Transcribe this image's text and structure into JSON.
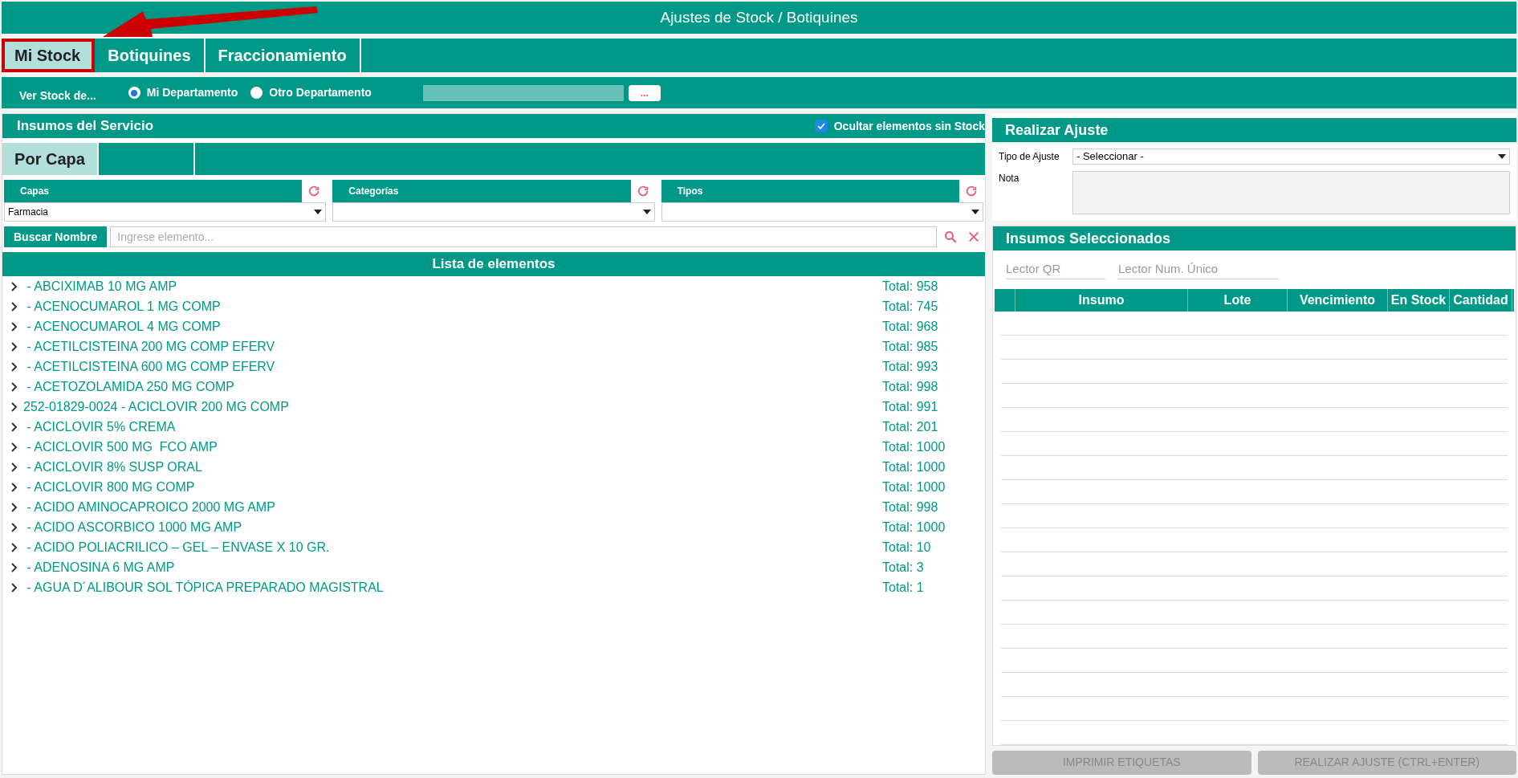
{
  "window": {
    "title": "Ajustes de Stock / Botiquines"
  },
  "tabs": [
    {
      "label": "Mi Stock",
      "selected": true,
      "highlighted": true
    },
    {
      "label": "Botiquines",
      "selected": false,
      "highlighted": false
    },
    {
      "label": "Fraccionamiento",
      "selected": false,
      "highlighted": false
    }
  ],
  "ver_stock": {
    "label": "Ver Stock de...",
    "options": [
      {
        "label": "Mi Departamento",
        "selected": true
      },
      {
        "label": "Otro Departamento",
        "selected": false
      }
    ],
    "browse_button": "..."
  },
  "insumos": {
    "title": "Insumos del Servicio",
    "hide_empty": {
      "label": "Ocultar elementos sin Stock",
      "checked": true
    },
    "subtabs": [
      {
        "label": "Por Capa",
        "selected": true
      }
    ],
    "filters": [
      {
        "label": "Capas",
        "value": "Farmacia"
      },
      {
        "label": "Categorías"
      },
      {
        "label": "Tipos"
      }
    ],
    "search": {
      "label": "Buscar Nombre",
      "placeholder": "Ingrese elemento..."
    },
    "list_title": "Lista de elementos",
    "items": [
      {
        "name": " - ABCIXIMAB 10 MG AMP",
        "total": "Total: 958"
      },
      {
        "name": " - ACENOCUMAROL 1 MG COMP",
        "total": "Total: 745"
      },
      {
        "name": " - ACENOCUMAROL 4 MG COMP",
        "total": "Total: 968"
      },
      {
        "name": " - ACETILCISTEINA 200 MG COMP EFERV",
        "total": "Total: 985"
      },
      {
        "name": " - ACETILCISTEINA 600 MG COMP EFERV",
        "total": "Total: 993"
      },
      {
        "name": " - ACETOZOLAMIDA 250 MG COMP",
        "total": "Total: 998"
      },
      {
        "name": "252-01829-0024 - ACICLOVIR 200 MG COMP",
        "total": "Total: 991"
      },
      {
        "name": " - ACICLOVIR 5% CREMA",
        "total": "Total: 201"
      },
      {
        "name": " - ACICLOVIR 500 MG  FCO AMP",
        "total": "Total: 1000"
      },
      {
        "name": " - ACICLOVIR 8% SUSP ORAL",
        "total": "Total: 1000"
      },
      {
        "name": " - ACICLOVIR 800 MG COMP",
        "total": "Total: 1000"
      },
      {
        "name": " - ACIDO AMINOCAPROICO 2000 MG AMP",
        "total": "Total: 998"
      },
      {
        "name": " - ACIDO ASCORBICO 1000 MG AMP",
        "total": "Total: 1000"
      },
      {
        "name": " - ACIDO POLIACRILICO – GEL – ENVASE X 10 GR.",
        "total": "Total: 10"
      },
      {
        "name": " - ADENOSINA 6 MG AMP",
        "total": "Total: 3"
      },
      {
        "name": " - AGUA D´ALIBOUR SOL TÓPICA PREPARADO MAGISTRAL",
        "total": "Total: 1"
      }
    ]
  },
  "ajuste": {
    "title": "Realizar Ajuste",
    "tipo_label": "Tipo de Ajuste",
    "tipo_value": "- Seleccionar -",
    "nota_label": "Nota"
  },
  "seleccionados": {
    "title": "Insumos Seleccionados",
    "qr_placeholder": "Lector QR",
    "num_placeholder": "Lector Num. Único",
    "columns": [
      "Insumo",
      "Lote",
      "Vencimiento",
      "En Stock",
      "Cantidad"
    ]
  },
  "buttons": [
    {
      "label": "IMPRIMIR ETIQUETAS",
      "disabled": true
    },
    {
      "label": "REALIZAR AJUSTE (CTRL+ENTER)",
      "disabled": true
    }
  ]
}
